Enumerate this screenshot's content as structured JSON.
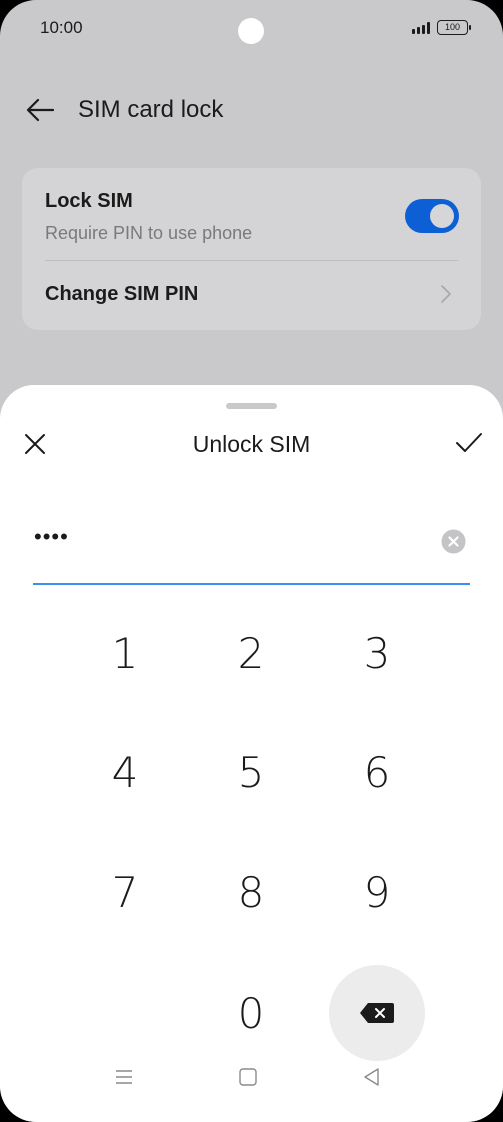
{
  "status_bar": {
    "time": "10:00",
    "battery": "100"
  },
  "header": {
    "title": "SIM card lock"
  },
  "settings": {
    "lock_sim": {
      "title": "Lock SIM",
      "subtitle": "Require PIN to use phone",
      "enabled": true
    },
    "change_pin": {
      "title": "Change SIM PIN"
    }
  },
  "dialog": {
    "title": "Unlock SIM",
    "pin_value": "••••"
  },
  "keypad": {
    "k1": "1",
    "k2": "2",
    "k3": "3",
    "k4": "4",
    "k5": "5",
    "k6": "6",
    "k7": "7",
    "k8": "8",
    "k9": "9",
    "k0": "0"
  },
  "colors": {
    "accent": "#0d5fd6",
    "underline": "#3b8ef2"
  }
}
